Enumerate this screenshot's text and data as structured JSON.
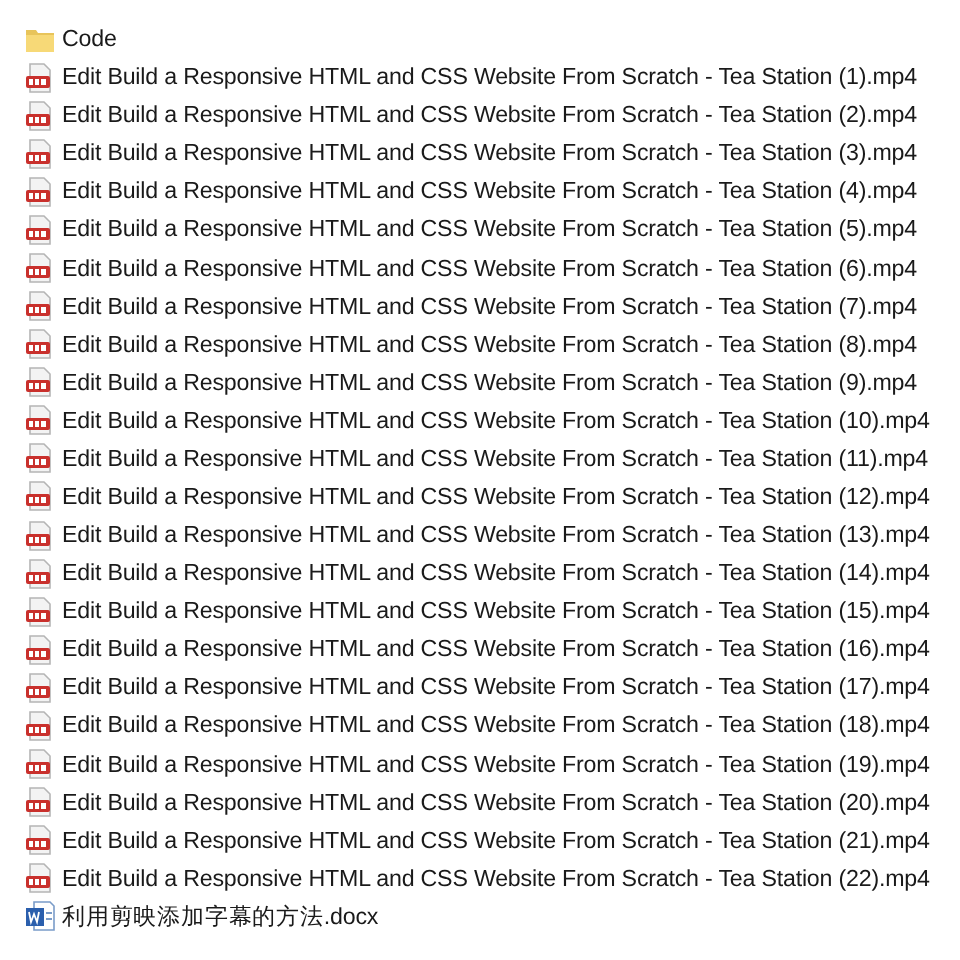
{
  "files": [
    {
      "kind": "folder",
      "name": "Code"
    },
    {
      "kind": "video",
      "name": "Edit Build a Responsive HTML and CSS Website From Scratch - Tea Station (1).mp4"
    },
    {
      "kind": "video",
      "name": "Edit Build a Responsive HTML and CSS Website From Scratch - Tea Station (2).mp4"
    },
    {
      "kind": "video",
      "name": "Edit Build a Responsive HTML and CSS Website From Scratch - Tea Station (3).mp4"
    },
    {
      "kind": "video",
      "name": "Edit Build a Responsive HTML and CSS Website From Scratch - Tea Station (4).mp4"
    },
    {
      "kind": "video",
      "name": "Edit Build a Responsive HTML and CSS Website From Scratch - Tea Station (5).mp4"
    },
    {
      "kind": "video",
      "name": "Edit Build a Responsive HTML and CSS Website From Scratch - Tea Station (6).mp4"
    },
    {
      "kind": "video",
      "name": "Edit Build a Responsive HTML and CSS Website From Scratch - Tea Station (7).mp4"
    },
    {
      "kind": "video",
      "name": "Edit Build a Responsive HTML and CSS Website From Scratch - Tea Station (8).mp4"
    },
    {
      "kind": "video",
      "name": "Edit Build a Responsive HTML and CSS Website From Scratch - Tea Station (9).mp4"
    },
    {
      "kind": "video",
      "name": "Edit Build a Responsive HTML and CSS Website From Scratch - Tea Station (10).mp4"
    },
    {
      "kind": "video",
      "name": "Edit Build a Responsive HTML and CSS Website From Scratch - Tea Station (11).mp4"
    },
    {
      "kind": "video",
      "name": "Edit Build a Responsive HTML and CSS Website From Scratch - Tea Station (12).mp4"
    },
    {
      "kind": "video",
      "name": "Edit Build a Responsive HTML and CSS Website From Scratch - Tea Station (13).mp4"
    },
    {
      "kind": "video",
      "name": "Edit Build a Responsive HTML and CSS Website From Scratch - Tea Station (14).mp4"
    },
    {
      "kind": "video",
      "name": "Edit Build a Responsive HTML and CSS Website From Scratch - Tea Station (15).mp4"
    },
    {
      "kind": "video",
      "name": "Edit Build a Responsive HTML and CSS Website From Scratch - Tea Station (16).mp4"
    },
    {
      "kind": "video",
      "name": "Edit Build a Responsive HTML and CSS Website From Scratch - Tea Station (17).mp4"
    },
    {
      "kind": "video",
      "name": "Edit Build a Responsive HTML and CSS Website From Scratch - Tea Station (18).mp4"
    },
    {
      "kind": "video",
      "name": "Edit Build a Responsive HTML and CSS Website From Scratch - Tea Station (19).mp4"
    },
    {
      "kind": "video",
      "name": "Edit Build a Responsive HTML and CSS Website From Scratch - Tea Station (20).mp4"
    },
    {
      "kind": "video",
      "name": "Edit Build a Responsive HTML and CSS Website From Scratch - Tea Station (21).mp4"
    },
    {
      "kind": "video",
      "name": "Edit Build a Responsive HTML and CSS Website From Scratch - Tea Station (22).mp4"
    },
    {
      "kind": "document",
      "name": "利用剪映添加字幕的方法.docx"
    }
  ]
}
